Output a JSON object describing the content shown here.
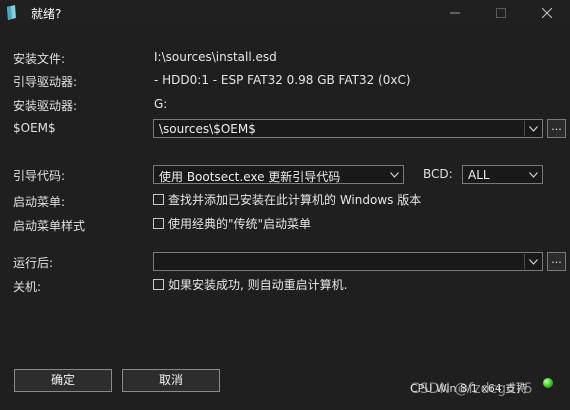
{
  "window": {
    "title": "就绪?"
  },
  "fields": {
    "install_file_label": "安装文件:",
    "install_file_value": "I:\\sources\\install.esd",
    "boot_drive_label": "引导驱动器:",
    "boot_drive_value": " - HDD0:1 - ESP FAT32 0.98 GB FAT32 (0xC)",
    "install_drive_label": "安装驱动器:",
    "install_drive_value": "G:",
    "oem_label": "$OEM$",
    "oem_value": "\\sources\\$OEM$",
    "oem_browse": "..."
  },
  "boot": {
    "boot_code_label": "引导代码:",
    "boot_code_value": "使用 Bootsect.exe 更新引导代码",
    "bcd_label": "BCD:",
    "bcd_value": "ALL",
    "boot_menu_label": "启动菜单:",
    "boot_menu_checkbox": "查找并添加已安装在此计算机的 Windows 版本",
    "boot_menu_style_label": "启动菜单样式",
    "boot_menu_style_checkbox": "使用经典的\"传统\"启动菜单"
  },
  "after": {
    "run_after_label": "运行后:",
    "run_after_value": "",
    "run_after_browse": "...",
    "shutdown_label": "关机:",
    "shutdown_checkbox": "如果安装成功, 则自动重启计算机."
  },
  "buttons": {
    "ok": "确定",
    "cancel": "取消"
  },
  "status": {
    "text": "CPU Win 8/1 x64 支持",
    "watermark": "CSDN @fzdcgd75",
    "led_color": "#38c21c"
  },
  "icons": {
    "app": "app-icon",
    "minimize": "minimize-icon",
    "maximize": "maximize-icon",
    "close": "close-icon",
    "dropdown": "chevron-down-icon"
  }
}
